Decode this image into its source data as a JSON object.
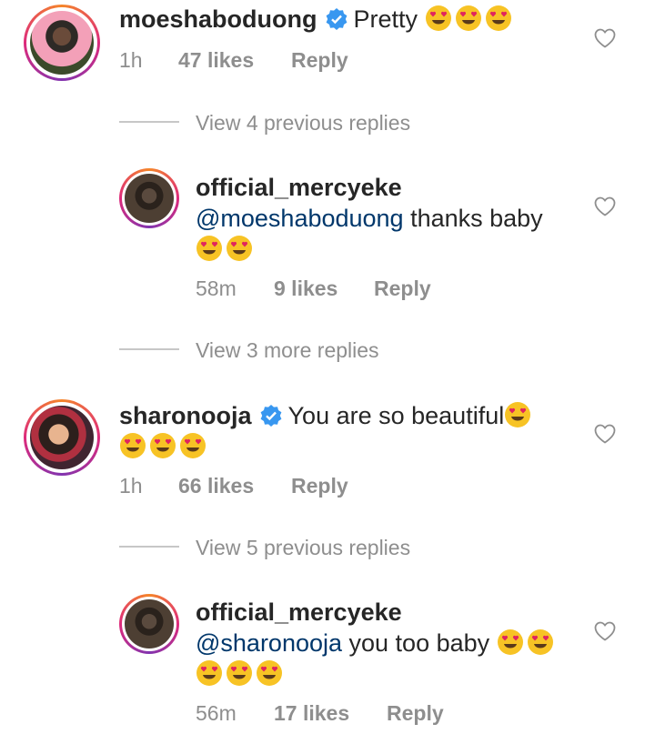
{
  "comments": [
    {
      "username": "moeshaboduong",
      "verified": true,
      "text": "Pretty",
      "emojis": [
        "heart-eyes-emoji",
        "heart-eyes-emoji",
        "heart-eyes-emoji"
      ],
      "time": "1h",
      "likes": "47 likes",
      "reply": "Reply",
      "view_replies": "View 4 previous replies"
    },
    {
      "username": "official_mercyeke",
      "mention": "@moeshaboduong",
      "text": " thanks baby",
      "emojis": [
        "heart-eyes-emoji",
        "heart-eyes-emoji"
      ],
      "time": "58m",
      "likes": "9 likes",
      "reply": "Reply",
      "view_replies": "View 3 more replies"
    },
    {
      "username": "sharonooja",
      "verified": true,
      "text": "You are so beautiful",
      "emojis": [
        "heart-eyes-emoji",
        "heart-eyes-emoji",
        "heart-eyes-emoji",
        "heart-eyes-emoji"
      ],
      "time": "1h",
      "likes": "66 likes",
      "reply": "Reply",
      "view_replies": "View 5 previous replies"
    },
    {
      "username": "official_mercyeke",
      "mention": "@sharonooja",
      "text": " you too baby",
      "emojis": [
        "heart-eyes-emoji",
        "heart-eyes-emoji",
        "heart-eyes-emoji",
        "heart-eyes-emoji",
        "heart-eyes-emoji"
      ],
      "time": "56m",
      "likes": "17 likes",
      "reply": "Reply"
    }
  ],
  "icons": {
    "like": "heart-outline-icon",
    "verified": "verified-badge-icon"
  },
  "colors": {
    "mention": "#00376b",
    "verified": "#3897f0",
    "meta": "#8e8e8e",
    "emoji": "#f7c325"
  }
}
